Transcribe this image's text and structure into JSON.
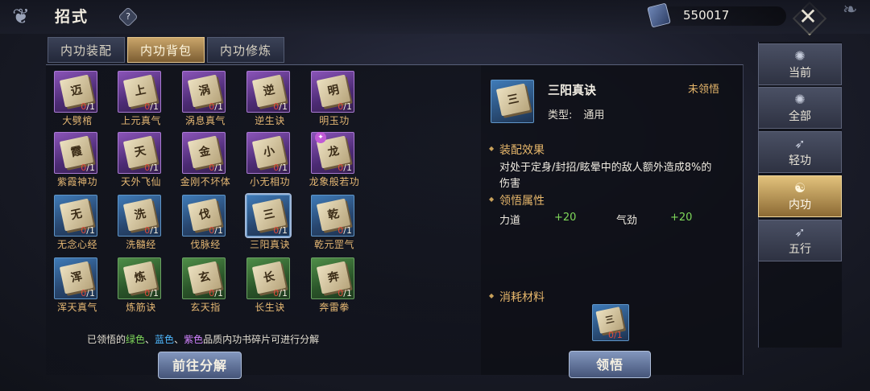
{
  "header": {
    "title": "招式",
    "help_icon": "?",
    "currency_value": "550017",
    "close_icon": "✕"
  },
  "tabs": [
    {
      "label": "内功装配",
      "active": false
    },
    {
      "label": "内功背包",
      "active": true
    },
    {
      "label": "内功修炼",
      "active": false
    }
  ],
  "grid": [
    {
      "name": "大劈棺",
      "glyph": "迈",
      "have": "0",
      "need": "/1",
      "quality": "purple"
    },
    {
      "name": "上元真气",
      "glyph": "上",
      "have": "0",
      "need": "/1",
      "quality": "purple"
    },
    {
      "name": "涡息真气",
      "glyph": "涡",
      "have": "0",
      "need": "/1",
      "quality": "purple"
    },
    {
      "name": "逆生诀",
      "glyph": "逆",
      "have": "0",
      "need": "/1",
      "quality": "purple"
    },
    {
      "name": "明玉功",
      "glyph": "明",
      "have": "0",
      "need": "/1",
      "quality": "purple"
    },
    {
      "name": "紫霞神功",
      "glyph": "霞",
      "have": "0",
      "need": "/1",
      "quality": "purple"
    },
    {
      "name": "天外飞仙",
      "glyph": "天",
      "have": "0",
      "need": "/1",
      "quality": "purple"
    },
    {
      "name": "金刚不坏体",
      "glyph": "金",
      "have": "0",
      "need": "/1",
      "quality": "purple"
    },
    {
      "name": "小无相功",
      "glyph": "小",
      "have": "0",
      "need": "/1",
      "quality": "purple"
    },
    {
      "name": "龙象般若功",
      "glyph": "龙",
      "have": "0",
      "need": "/1",
      "quality": "purple",
      "badge": true
    },
    {
      "name": "无念心经",
      "glyph": "无",
      "have": "0",
      "need": "/1",
      "quality": "blue"
    },
    {
      "name": "洗髓经",
      "glyph": "洗",
      "have": "0",
      "need": "/1",
      "quality": "blue"
    },
    {
      "name": "伐脉经",
      "glyph": "伐",
      "have": "0",
      "need": "/1",
      "quality": "blue"
    },
    {
      "name": "三阳真诀",
      "glyph": "三",
      "have": "0",
      "need": "/1",
      "quality": "blue",
      "selected": true
    },
    {
      "name": "乾元罡气",
      "glyph": "乾",
      "have": "0",
      "need": "/1",
      "quality": "blue"
    },
    {
      "name": "浑天真气",
      "glyph": "浑",
      "have": "0",
      "need": "/1",
      "quality": "blue"
    },
    {
      "name": "炼筋诀",
      "glyph": "炼",
      "have": "0",
      "need": "/1",
      "quality": "green"
    },
    {
      "name": "玄天指",
      "glyph": "玄",
      "have": "0",
      "need": "/1",
      "quality": "green"
    },
    {
      "name": "长生诀",
      "glyph": "长",
      "have": "0",
      "need": "/1",
      "quality": "green"
    },
    {
      "name": "奔雷拳",
      "glyph": "奔",
      "have": "0",
      "need": "/1",
      "quality": "green"
    }
  ],
  "hint": {
    "prefix": "已领悟的",
    "green": "绿色",
    "sep1": "、",
    "blue": "蓝色",
    "sep2": "、",
    "purple": "紫色",
    "suffix": "品质内功书碎片可进行分解"
  },
  "buttons": {
    "decompose": "前往分解",
    "comprehend": "领悟"
  },
  "detail": {
    "name": "三阳真诀",
    "glyph": "三",
    "status": "未领悟",
    "type_label": "类型:",
    "type_value": "通用",
    "effect_title": "装配效果",
    "effect_text": "对处于定身/封招/眩晕中的敌人额外造成8%的伤害",
    "attr_title": "领悟属性",
    "attrs": [
      {
        "label": "力道",
        "value": "+20"
      },
      {
        "label": "气劲",
        "value": "+20"
      }
    ],
    "material_title": "消耗材料",
    "material_count": "0/1"
  },
  "categories": [
    {
      "label": "当前",
      "icon": "✺",
      "active": false
    },
    {
      "label": "全部",
      "icon": "✺",
      "active": false
    },
    {
      "label": "轻功",
      "icon": "➶",
      "active": false
    },
    {
      "label": "内功",
      "icon": "☯",
      "active": true
    },
    {
      "label": "五行",
      "icon": "➶",
      "active": false
    }
  ],
  "colors": {
    "accent_gold": "#e7b76b",
    "green_value": "#7fd95a",
    "count_red": "#e04b3c"
  }
}
